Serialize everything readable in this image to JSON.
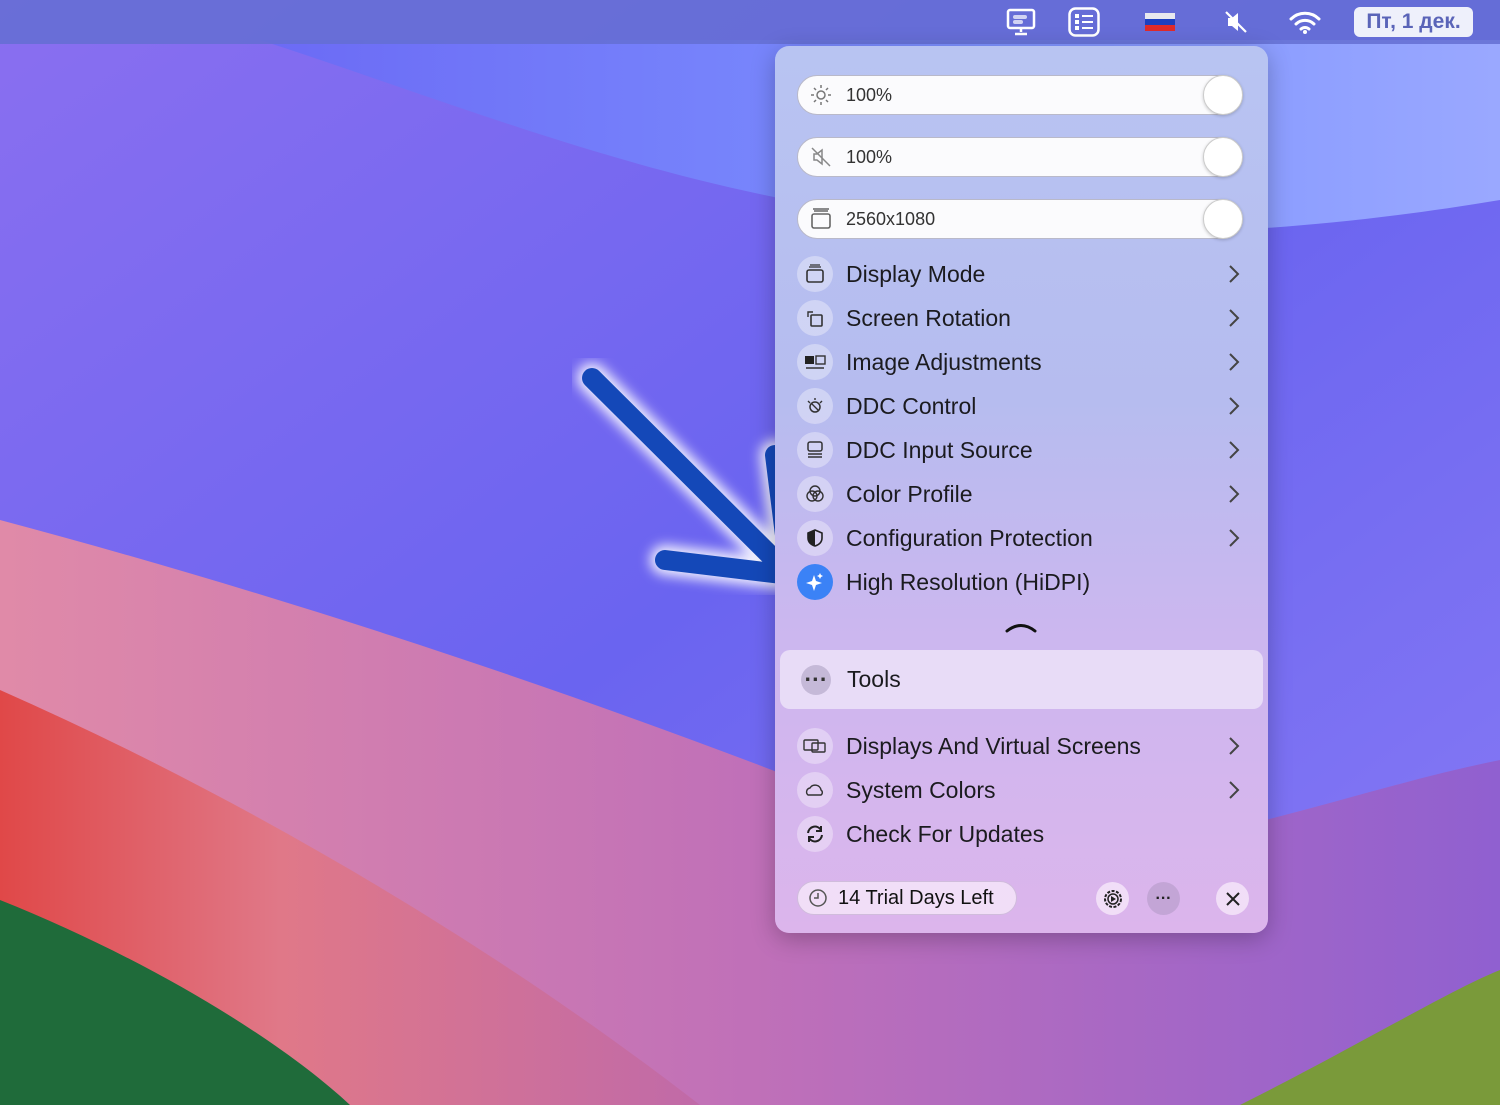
{
  "menubar": {
    "icons": [
      "display-icon",
      "list-icon",
      "russian-flag-icon",
      "speaker-muted-icon",
      "wifi-icon"
    ],
    "clock": "Пт, 1 дек."
  },
  "sliders": [
    {
      "icon": "brightness-icon",
      "label": "100%",
      "value": 1.0
    },
    {
      "icon": "speaker-muted-icon",
      "label": "100%",
      "value": 1.0
    },
    {
      "icon": "display-mode-icon",
      "label": "2560x1080",
      "value": 1.0
    }
  ],
  "menu": [
    {
      "label": "Display Mode",
      "icon": "display-mode-icon",
      "submenu": true
    },
    {
      "label": "Screen Rotation",
      "icon": "rotation-icon",
      "submenu": true
    },
    {
      "label": "Image Adjustments",
      "icon": "image-adjust-icon",
      "submenu": true
    },
    {
      "label": "DDC Control",
      "icon": "ddc-icon",
      "submenu": true
    },
    {
      "label": "DDC Input Source",
      "icon": "input-source-icon",
      "submenu": true
    },
    {
      "label": "Color Profile",
      "icon": "color-profile-icon",
      "submenu": true
    },
    {
      "label": "Configuration Protection",
      "icon": "shield-icon",
      "submenu": true
    },
    {
      "label": "High Resolution (HiDPI)",
      "icon": "sparkle-icon",
      "submenu": false
    }
  ],
  "tools": {
    "label": "Tools"
  },
  "menu2": [
    {
      "label": "Displays And Virtual Screens",
      "submenu": true
    },
    {
      "label": "System Colors",
      "submenu": true
    },
    {
      "label": "Check For Updates",
      "submenu": false
    }
  ],
  "footer": {
    "trial": "14 Trial Days Left"
  },
  "colors": {
    "accent": "#3b82f6",
    "arrow": "#1448b8"
  }
}
